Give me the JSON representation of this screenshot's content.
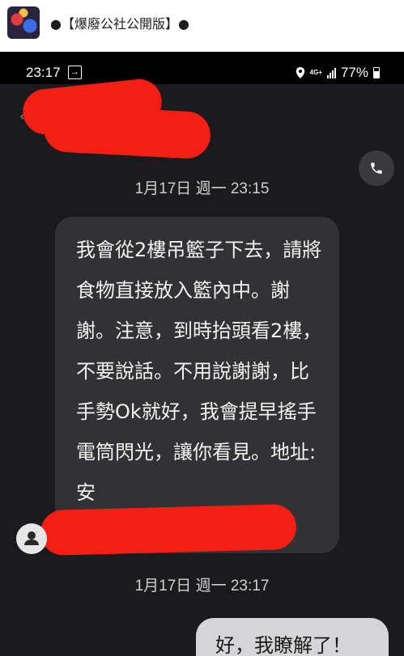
{
  "post": {
    "group_name": "●【爆廢公社公開版】●"
  },
  "status_bar": {
    "time": "23:17",
    "network": "4G+",
    "battery": "77%"
  },
  "conversation": {
    "timestamps": [
      "1月17日 週一 23:15",
      "1月17日 週一 23:17"
    ],
    "incoming_message": "我會從2樓吊籃子下去，請將食物直接放入籃內中。謝謝。注意，到時抬頭看2樓，不要說話。不用說謝謝，比手勢Ok就好，我會提早搖手電筒閃光，讓你看見。地址:安",
    "outgoing_message": "好，我瞭解了！"
  },
  "icons": [
    "group-avatar",
    "location-icon",
    "signal-icon",
    "battery-icon",
    "phone-icon",
    "contact-avatar-icon"
  ],
  "colors": {
    "chat_bg": "#1b1b1d",
    "incoming_bubble": "#323235",
    "outgoing_bubble": "#d5d5d7",
    "redaction": "#f31f14"
  }
}
